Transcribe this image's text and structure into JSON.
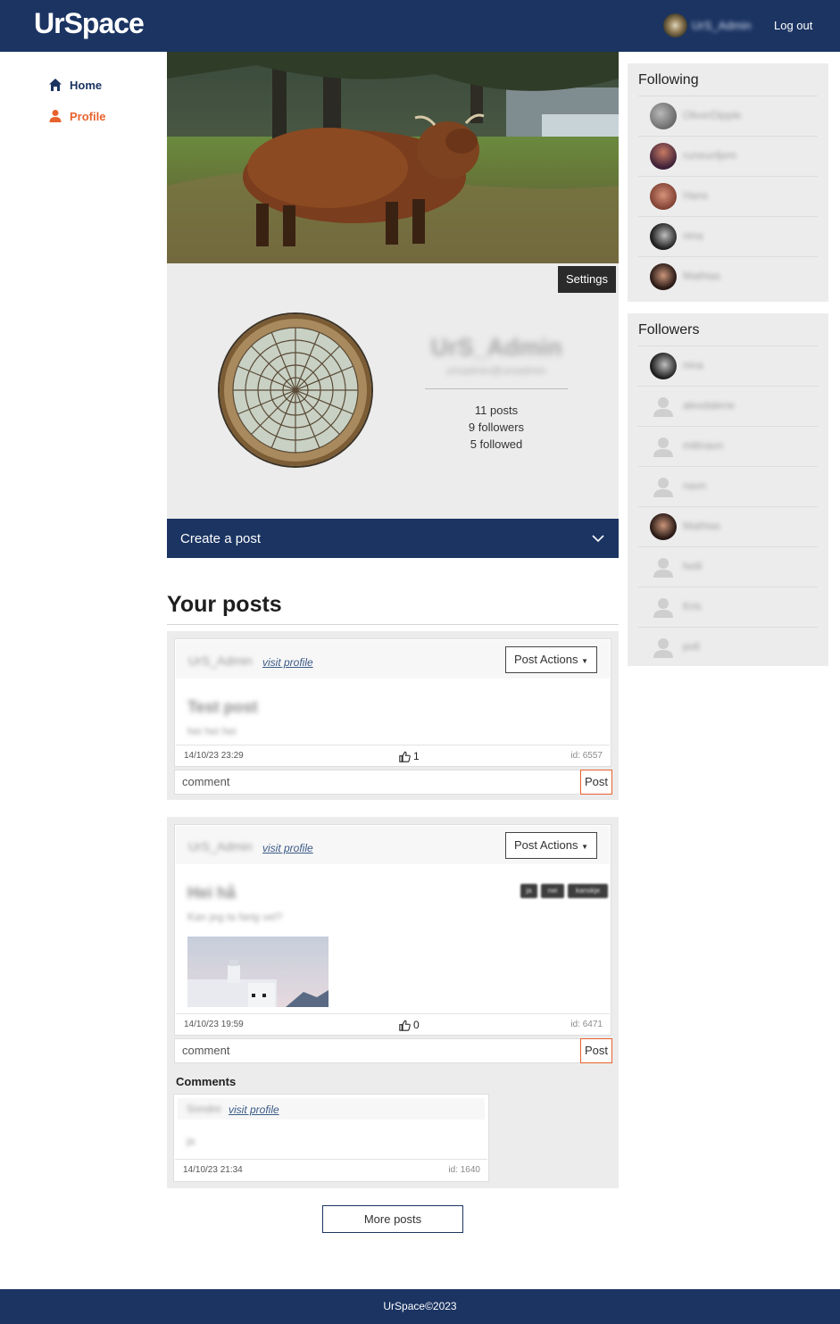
{
  "header": {
    "logo": "UrSpace",
    "username": "UrS_Admin",
    "logout_label": "Log out"
  },
  "sidebar": {
    "items": [
      {
        "label": "Home",
        "icon": "home-icon"
      },
      {
        "label": "Profile",
        "icon": "person-icon"
      }
    ]
  },
  "profile": {
    "settings_label": "Settings",
    "name": "UrS_Admin",
    "handle": "ursadmin@ursadmin",
    "posts": "11 posts",
    "followers": "9 followers",
    "followed": "5 followed",
    "create_post_label": "Create a post"
  },
  "posts_section": {
    "title": "Your posts",
    "visit_label": "visit profile",
    "actions_label": "Post Actions",
    "comment_placeholder": "comment",
    "post_button": "Post",
    "comments_title": "Comments",
    "more_posts": "More posts",
    "posts": [
      {
        "author": "UrS_Admin",
        "title": "Test post",
        "body": "hei hei hei",
        "date": "14/10/23 23:29",
        "likes": "1",
        "id": "id: 6557"
      },
      {
        "author": "UrS_Admin",
        "title": "Hei hå",
        "body": "Kan jeg ta farig vel?",
        "date": "14/10/23 19:59",
        "likes": "0",
        "id": "id: 6471",
        "tags": [
          "ja",
          "nei",
          "kanskje"
        ]
      }
    ],
    "comment": {
      "author": "Sondre",
      "body": "ja",
      "date": "14/10/23 21:34",
      "id": "id: 1640"
    }
  },
  "following": {
    "title": "Following",
    "users": [
      "OliverDipple",
      "runeunfjem",
      "Hans",
      "nina",
      "Mathias"
    ]
  },
  "followers": {
    "title": "Followers",
    "users": [
      "nina",
      "alexdalene",
      "mittnavn",
      "navn",
      "Mathias",
      "heili",
      "Kris",
      "poll"
    ]
  },
  "footer": {
    "text": "UrSpace©2023"
  },
  "colors": {
    "navy": "#1b3462",
    "accent": "#e8622d",
    "panel": "#ececec"
  }
}
